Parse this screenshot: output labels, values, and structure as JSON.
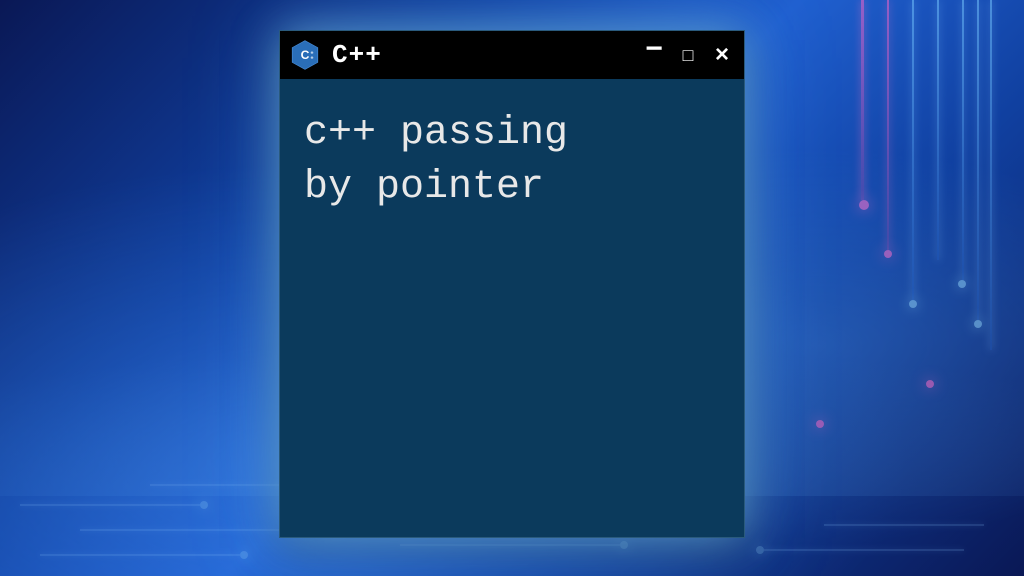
{
  "window": {
    "title": "C++",
    "icon_label": "C++",
    "controls": {
      "minimize": "−",
      "maximize": "□",
      "close": "×"
    }
  },
  "terminal": {
    "content": "c++ passing\nby pointer"
  },
  "colors": {
    "terminal_bg": "#0b3a5c",
    "titlebar_bg": "#000000",
    "text": "#e8e8e8",
    "icon_blue": "#2a6eb8"
  }
}
